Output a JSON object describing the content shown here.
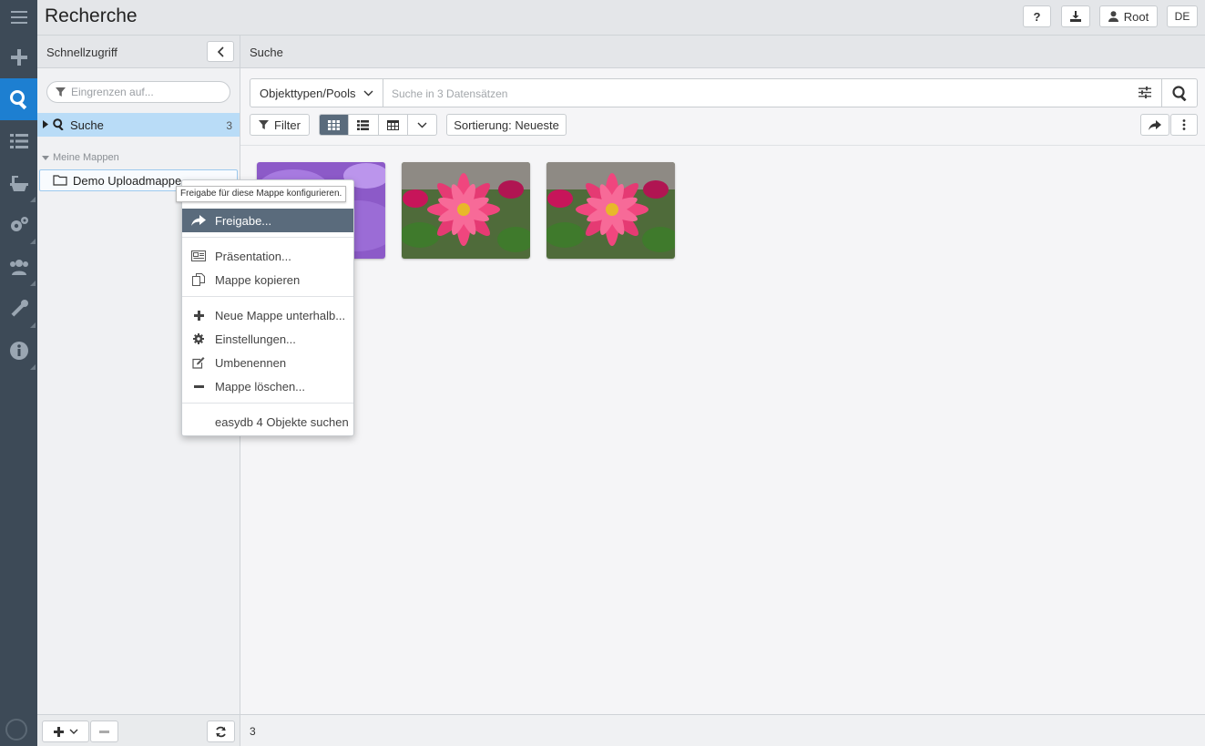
{
  "app": {
    "title": "Recherche"
  },
  "topbar": {
    "help_label": "?",
    "user_label": "Root",
    "lang_label": "DE"
  },
  "sidebar": {
    "title": "Schnellzugriff",
    "filter_placeholder": "Eingrenzen auf...",
    "search_item": {
      "label": "Suche",
      "count": "3"
    },
    "section_label": "Meine Mappen",
    "folder": {
      "label": "Demo Uploadmappe"
    }
  },
  "main": {
    "title": "Suche",
    "objtype_label": "Objekttypen/Pools",
    "search_placeholder": "Suche in 3 Datensätzen",
    "filter_label": "Filter",
    "sort_label": "Sortierung: Neueste",
    "footer_count": "3"
  },
  "context_menu": {
    "tooltip": "Freigabe für diese Mappe konfigurieren.",
    "items": [
      {
        "label": "Freigabe...",
        "icon": "share-icon"
      },
      {
        "label": "Präsentation...",
        "icon": "presentation-icon"
      },
      {
        "label": "Mappe kopieren",
        "icon": "copy-icon"
      },
      {
        "label": "Neue Mappe unterhalb...",
        "icon": "plus-icon"
      },
      {
        "label": "Einstellungen...",
        "icon": "gear-icon"
      },
      {
        "label": "Umbenennen",
        "icon": "edit-icon"
      },
      {
        "label": "Mappe löschen...",
        "icon": "minus-icon"
      },
      {
        "label": "easydb 4 Objekte suchen",
        "icon": ""
      }
    ]
  },
  "colors": {
    "accent": "#1d7fd1",
    "rail": "#3d4a57",
    "selected": "#b9dcf7",
    "menu_active": "#5a6b7c"
  }
}
